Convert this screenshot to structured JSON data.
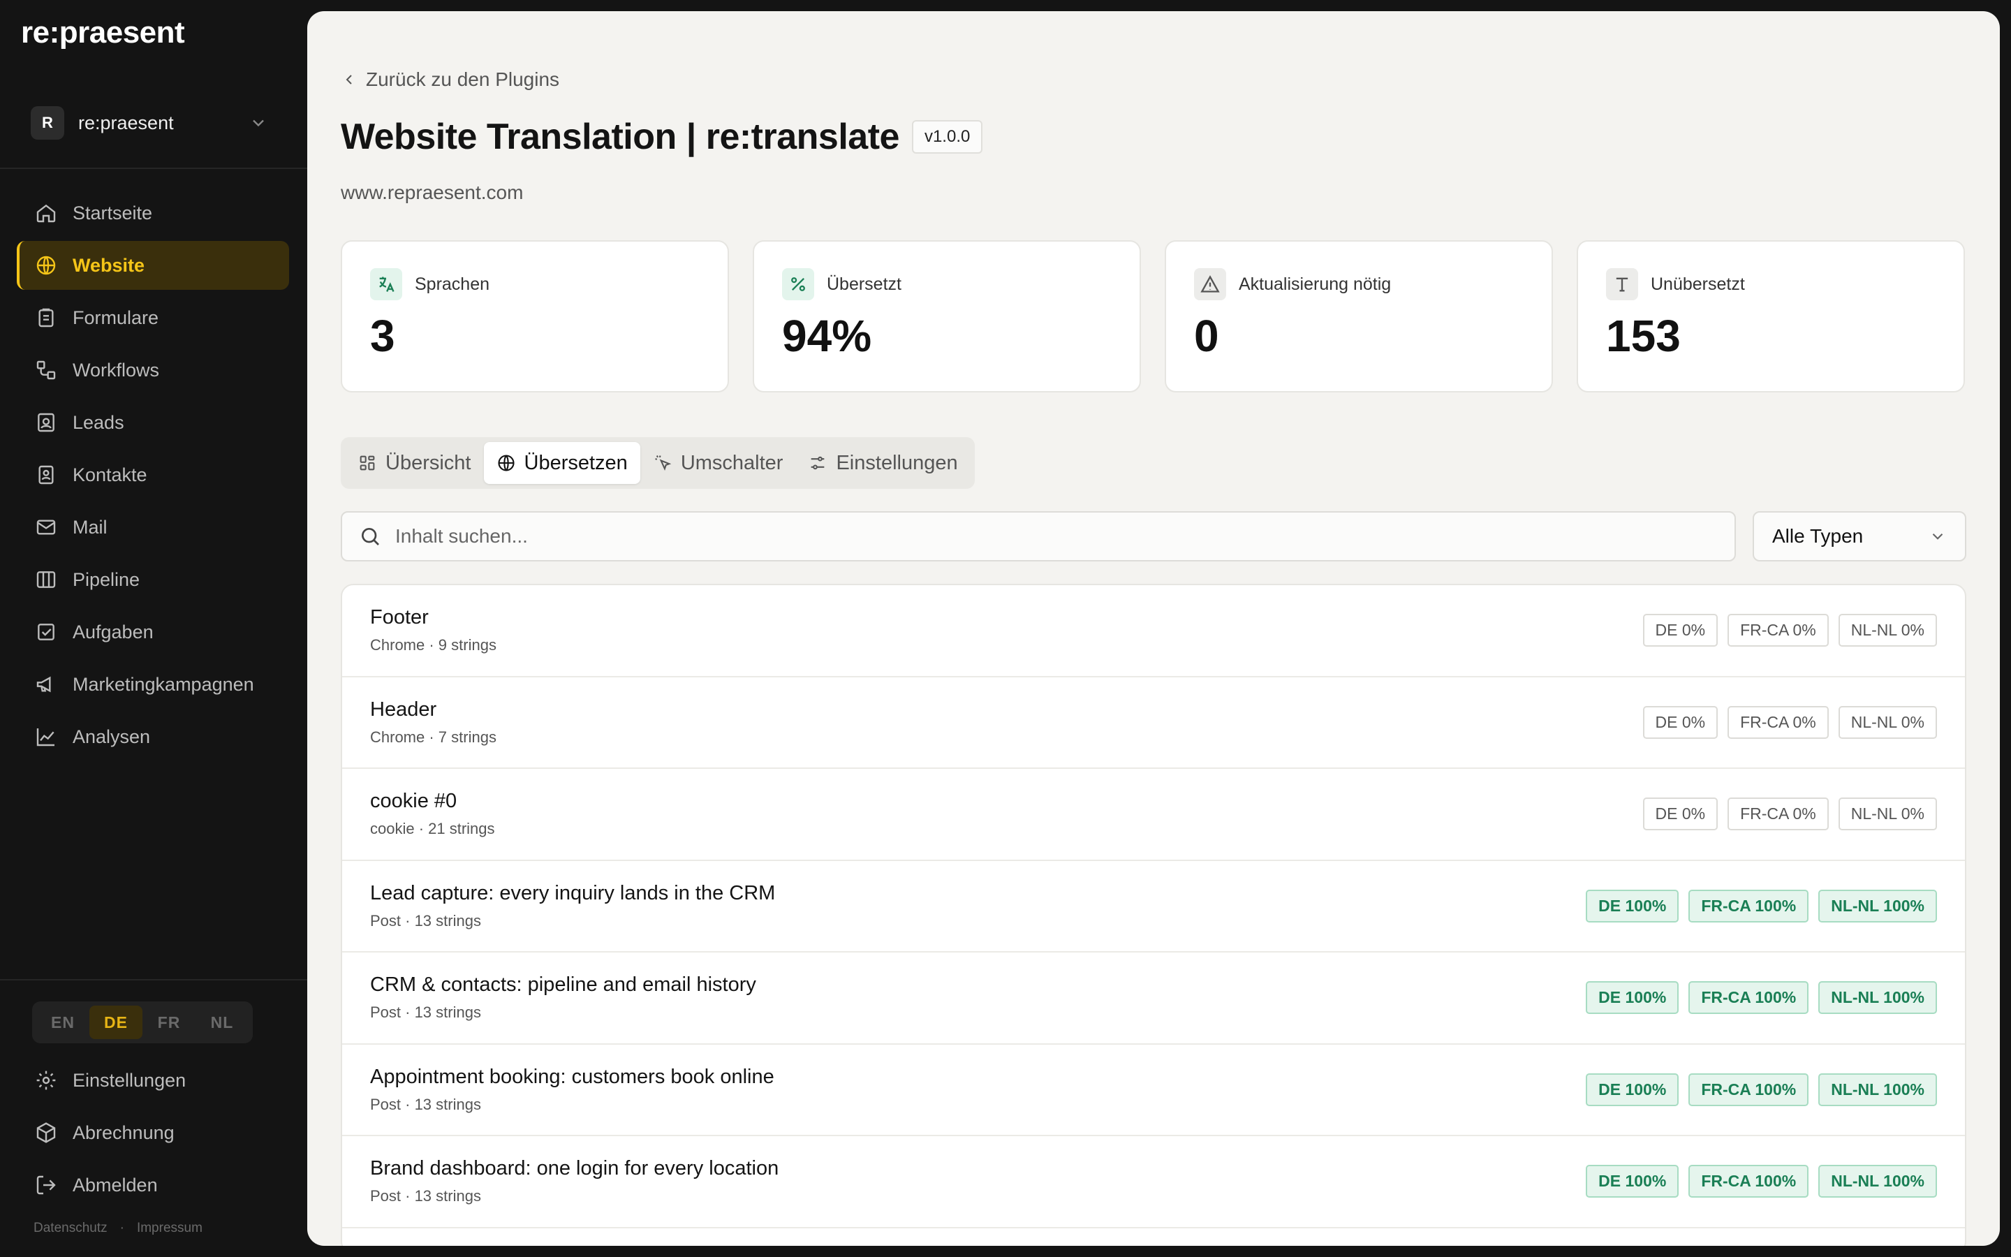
{
  "brand": "re:praesent",
  "workspace": {
    "initial": "R",
    "name": "re:praesent"
  },
  "nav": [
    {
      "label": "Startseite",
      "icon": "home-icon"
    },
    {
      "label": "Website",
      "icon": "globe-icon",
      "active": true
    },
    {
      "label": "Formulare",
      "icon": "clipboard-icon"
    },
    {
      "label": "Workflows",
      "icon": "workflow-icon"
    },
    {
      "label": "Leads",
      "icon": "lead-icon"
    },
    {
      "label": "Kontakte",
      "icon": "contact-icon"
    },
    {
      "label": "Mail",
      "icon": "mail-icon"
    },
    {
      "label": "Pipeline",
      "icon": "pipeline-icon"
    },
    {
      "label": "Aufgaben",
      "icon": "task-icon"
    },
    {
      "label": "Marketingkampagnen",
      "icon": "megaphone-icon"
    },
    {
      "label": "Analysen",
      "icon": "chart-icon"
    }
  ],
  "languages": [
    "EN",
    "DE",
    "FR",
    "NL"
  ],
  "active_language": "DE",
  "bottom_nav": [
    {
      "label": "Einstellungen",
      "icon": "gear-icon"
    },
    {
      "label": "Abrechnung",
      "icon": "box-icon"
    },
    {
      "label": "Abmelden",
      "icon": "logout-icon"
    }
  ],
  "legal": {
    "privacy": "Datenschutz",
    "imprint": "Impressum"
  },
  "main": {
    "back_label": "Zurück zu den Plugins",
    "title": "Website Translation | re:translate",
    "version": "v1.0.0",
    "domain": "www.repraesent.com"
  },
  "stats": [
    {
      "label": "Sprachen",
      "value": "3",
      "icon": "translate-icon"
    },
    {
      "label": "Übersetzt",
      "value": "94%",
      "icon": "percent-icon"
    },
    {
      "label": "Aktualisierung nötig",
      "value": "0",
      "icon": "warning-icon"
    },
    {
      "label": "Unübersetzt",
      "value": "153",
      "icon": "text-icon"
    }
  ],
  "tabs": [
    {
      "label": "Übersicht",
      "icon": "grid-icon"
    },
    {
      "label": "Übersetzen",
      "icon": "globe-icon",
      "active": true
    },
    {
      "label": "Umschalter",
      "icon": "pointer-icon"
    },
    {
      "label": "Einstellungen",
      "icon": "sliders-icon"
    }
  ],
  "search": {
    "placeholder": "Inhalt suchen..."
  },
  "type_filter": {
    "value": "Alle Typen"
  },
  "rows": [
    {
      "title": "Footer",
      "sub": "Chrome · 9 strings",
      "badges": [
        "DE 0%",
        "FR-CA 0%",
        "NL-NL 0%"
      ],
      "done": false
    },
    {
      "title": "Header",
      "sub": "Chrome · 7 strings",
      "badges": [
        "DE 0%",
        "FR-CA 0%",
        "NL-NL 0%"
      ],
      "done": false
    },
    {
      "title": "cookie #0",
      "sub": "cookie · 21 strings",
      "badges": [
        "DE 0%",
        "FR-CA 0%",
        "NL-NL 0%"
      ],
      "done": false
    },
    {
      "title": "Lead capture: every inquiry lands in the CRM",
      "sub": "Post · 13 strings",
      "badges": [
        "DE 100%",
        "FR-CA 100%",
        "NL-NL 100%"
      ],
      "done": true
    },
    {
      "title": "CRM & contacts: pipeline and email history",
      "sub": "Post · 13 strings",
      "badges": [
        "DE 100%",
        "FR-CA 100%",
        "NL-NL 100%"
      ],
      "done": true
    },
    {
      "title": "Appointment booking: customers book online",
      "sub": "Post · 13 strings",
      "badges": [
        "DE 100%",
        "FR-CA 100%",
        "NL-NL 100%"
      ],
      "done": true
    },
    {
      "title": "Brand dashboard: one login for every location",
      "sub": "Post · 13 strings",
      "badges": [
        "DE 100%",
        "FR-CA 100%",
        "NL-NL 100%"
      ],
      "done": true
    }
  ],
  "colors": {
    "accent": "#f5c518",
    "success": "#1a7f55",
    "sidebar": "#141414",
    "panel": "#f4f3f0"
  }
}
